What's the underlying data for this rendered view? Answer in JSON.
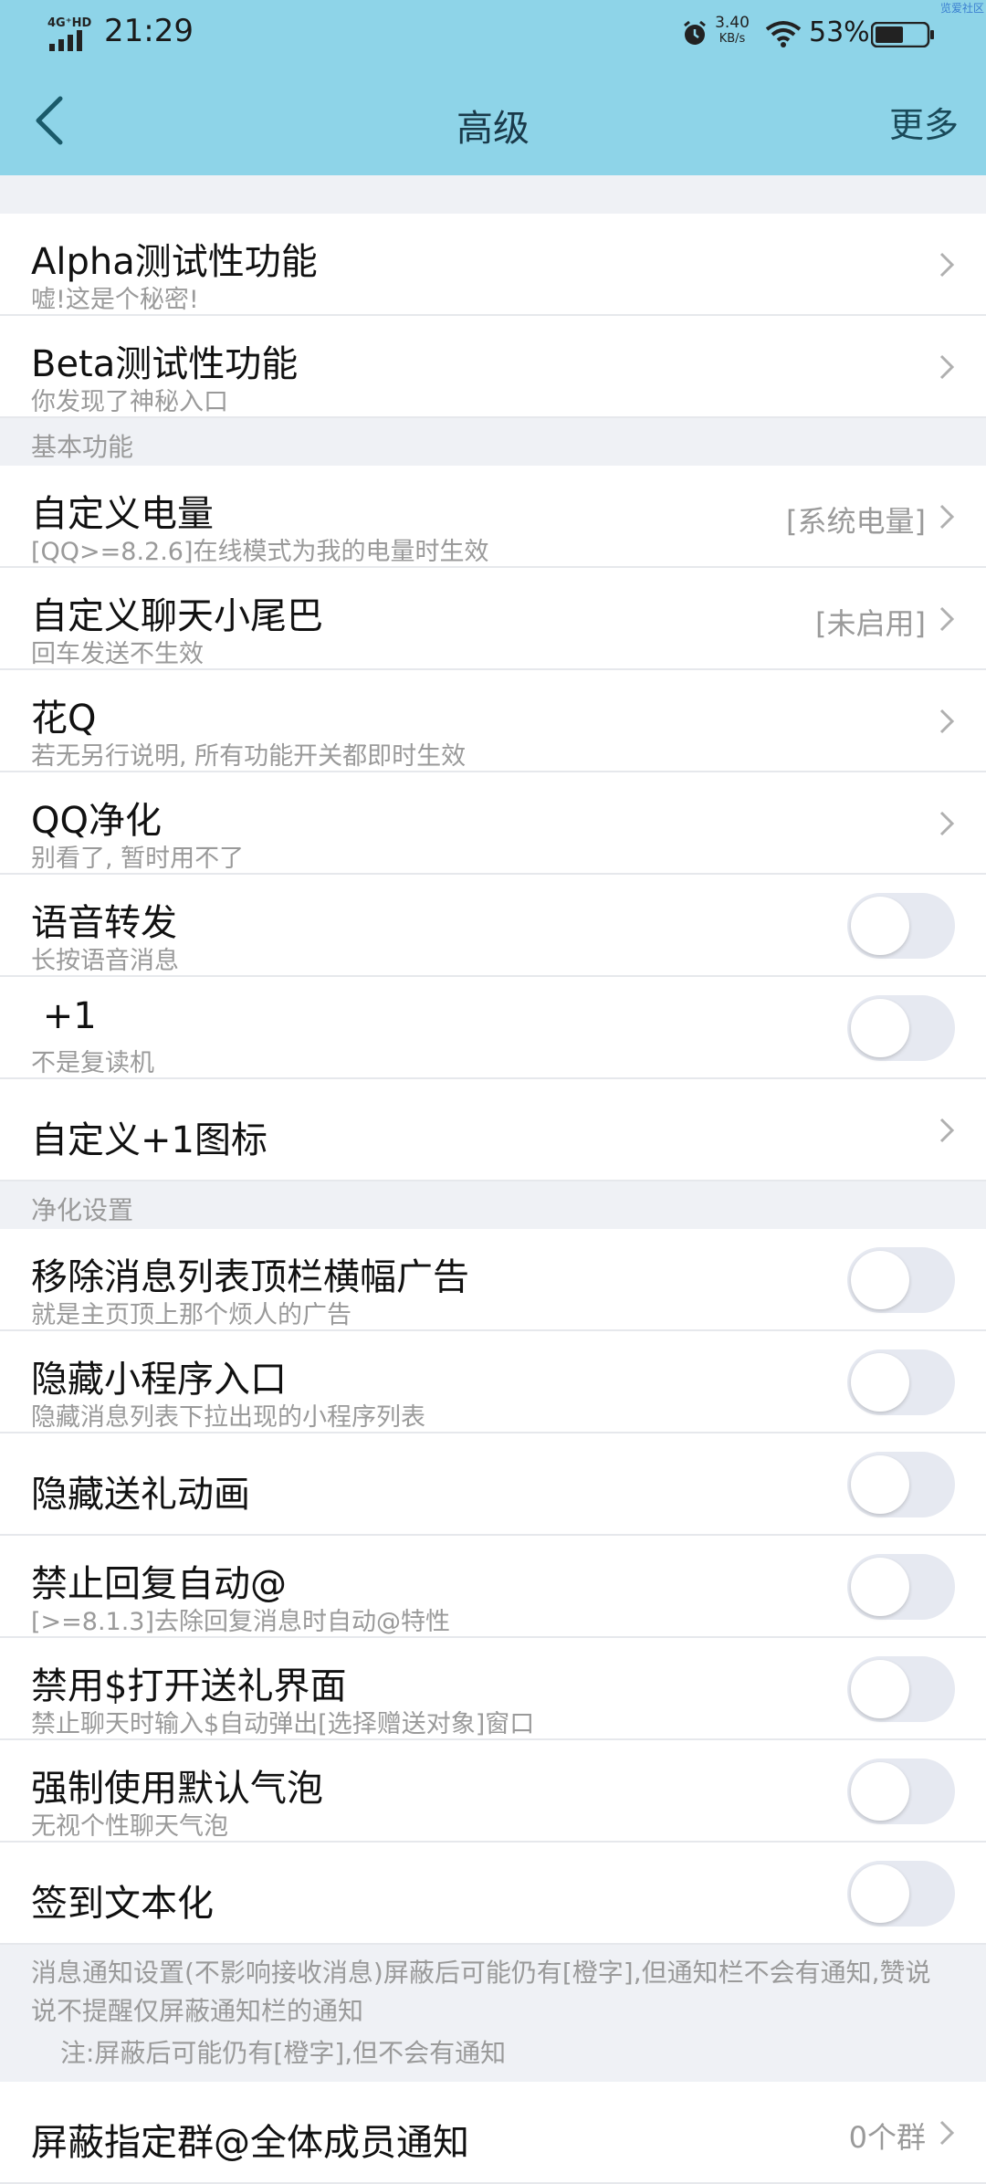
{
  "status_bar": {
    "network": "4G⁺HD",
    "time": "21:29",
    "speed_value": "3.40",
    "speed_unit": "KB/s",
    "battery": "53%",
    "watermark": "览爱社区"
  },
  "title_bar": {
    "title": "高级",
    "more": "更多"
  },
  "sections": {
    "basic": "基本功能",
    "purify": "净化设置"
  },
  "items": [
    {
      "title": "Alpha测试性功能",
      "subtitle": "嘘!这是个秘密!"
    },
    {
      "title": "Beta测试性功能",
      "subtitle": "你发现了神秘入口"
    },
    {
      "title": "自定义电量",
      "subtitle": "[QQ>=8.2.6]在线模式为我的电量时生效",
      "value": "[系统电量]"
    },
    {
      "title": "自定义聊天小尾巴",
      "subtitle": "回车发送不生效",
      "value": "[未启用]"
    },
    {
      "title": "花Q",
      "subtitle": "若无另行说明, 所有功能开关都即时生效"
    },
    {
      "title": "QQ净化",
      "subtitle": "别看了, 暂时用不了"
    },
    {
      "title": "语音转发",
      "subtitle": "长按语音消息",
      "enabled": false
    },
    {
      "title": " +1",
      "subtitle": "不是复读机",
      "enabled": false
    },
    {
      "title": "自定义+1图标"
    },
    {
      "title": "移除消息列表顶栏横幅广告",
      "subtitle": "就是主页顶上那个烦人的广告",
      "enabled": false
    },
    {
      "title": "隐藏小程序入口",
      "subtitle": "隐藏消息列表下拉出现的小程序列表",
      "enabled": false
    },
    {
      "title": "隐藏送礼动画",
      "enabled": false
    },
    {
      "title": "禁止回复自动@",
      "subtitle": "[>=8.1.3]去除回复消息时自动@特性",
      "enabled": false
    },
    {
      "title": "禁用$打开送礼界面",
      "subtitle": "禁止聊天时输入$自动弹出[选择赠送对象]窗口",
      "enabled": false
    },
    {
      "title": "强制使用默认气泡",
      "subtitle": "无视个性聊天气泡",
      "enabled": false
    },
    {
      "title": "签到文本化",
      "enabled": false
    },
    {
      "title": "屏蔽指定群@全体成员通知",
      "value": "0个群"
    }
  ],
  "notice": {
    "line1": "消息通知设置(不影响接收消息)屏蔽后可能仍有[橙字],但通知栏不会有通知,赞说说不提醒仅屏蔽通知栏的通知",
    "line2": "注:屏蔽后可能仍有[橙字],但不会有通知"
  },
  "colors": {
    "header": "#8ed4e8",
    "background": "#eff1f5",
    "toggle_off": "#e6e9f1"
  }
}
